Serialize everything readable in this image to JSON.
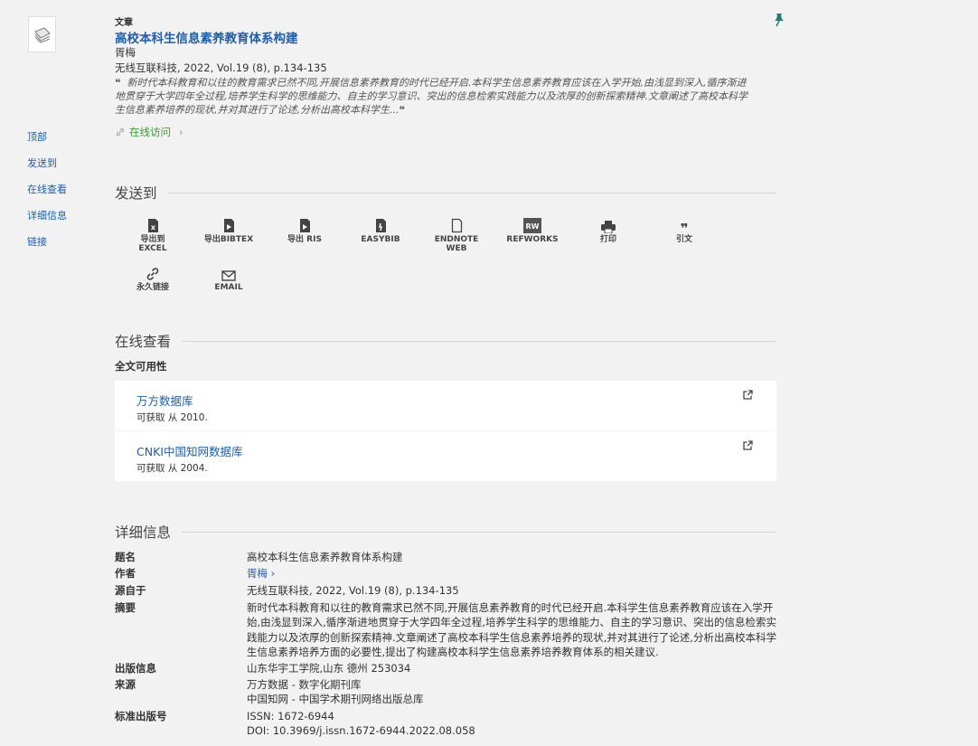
{
  "record": {
    "type": "文章",
    "title": "高校本科生信息素养教育体系构建",
    "author": "胥梅",
    "source": "无线互联科技, 2022, Vol.19 (8), p.134-135",
    "snippet": "新时代本科教育和以往的教育需求已然不同,开展信息素养教育的时代已经开启.本科学生信息素养教育应该在入学开始,由浅显到深入,循序渐进地贯穿于大学四年全过程,培养学生科学的思维能力、自主的学习意识、突出的信息检索实践能力以及浓厚的创新探索精神.文章阐述了高校本科学生信息素养培养的现状,并对其进行了论述,分析出高校本科学生...",
    "online_access": "在线访问"
  },
  "leftnav": [
    "顶部",
    "发送到",
    "在线查看",
    "详细信息",
    "链接"
  ],
  "sendto": {
    "heading": "发送到",
    "buttons": [
      {
        "label": "导出到\nEXCEL",
        "icon": "excel-file-icon"
      },
      {
        "label": "导出BIBTEX",
        "icon": "bibtex-file-icon"
      },
      {
        "label": "导出 RIS",
        "icon": "ris-file-icon"
      },
      {
        "label": "EASYBIB",
        "icon": "easybib-icon"
      },
      {
        "label": "ENDNOTE\nWEB",
        "icon": "endnote-icon"
      },
      {
        "label": "REFWORKS",
        "icon": "refworks-icon"
      },
      {
        "label": "打印",
        "icon": "print-icon"
      },
      {
        "label": "引文",
        "icon": "quote-icon"
      },
      {
        "label": "永久链接",
        "icon": "link-icon"
      },
      {
        "label": "EMAIL",
        "icon": "email-icon"
      }
    ]
  },
  "online_view": {
    "heading": "在线查看",
    "availability_heading": "全文可用性",
    "sources": [
      {
        "name": "万方数据库",
        "since": "可获取 从 2010."
      },
      {
        "name": "CNKI中国知网数据库",
        "since": "可获取 从 2004."
      }
    ]
  },
  "details": {
    "heading": "详细信息",
    "rows": [
      {
        "label": "题名",
        "value": "高校本科生信息素养教育体系构建"
      },
      {
        "label": "作者",
        "value": "胥梅 ›"
      },
      {
        "label": "源自于",
        "value": "无线互联科技, 2022, Vol.19 (8), p.134-135"
      },
      {
        "label": "摘要",
        "value": "新时代本科教育和以往的教育需求已然不同,开展信息素养教育的时代已经开启.本科学生信息素养教育应该在入学开始,由浅显到深入,循序渐进地贯穿于大学四年全过程,培养学生科学的思维能力、自主的学习意识、突出的信息检索实践能力以及浓厚的创新探索精神.文章阐述了高校本科学生信息素养培养的现状,并对其进行了论述,分析出高校本科学生信息素养培养方面的必要性,提出了构建高校本科学生信息素养培养教育体系的相关建议."
      },
      {
        "label": "出版信息",
        "value": "山东华宇工学院,山东 德州 253034"
      },
      {
        "label": "来源",
        "value": "万方数据 - 数字化期刊库\n中国知网 - 中国学术期刊网络出版总库"
      },
      {
        "label": "标准出版号",
        "value": "ISSN: 1672-6944\nDOI: 10.3969/j.issn.1672-6944.2022.08.058"
      }
    ]
  },
  "colors": {
    "link": "#1f5ea8",
    "online": "#3b9b3b",
    "pin": "#1a7f7a",
    "highlight": "#f5d76e"
  }
}
